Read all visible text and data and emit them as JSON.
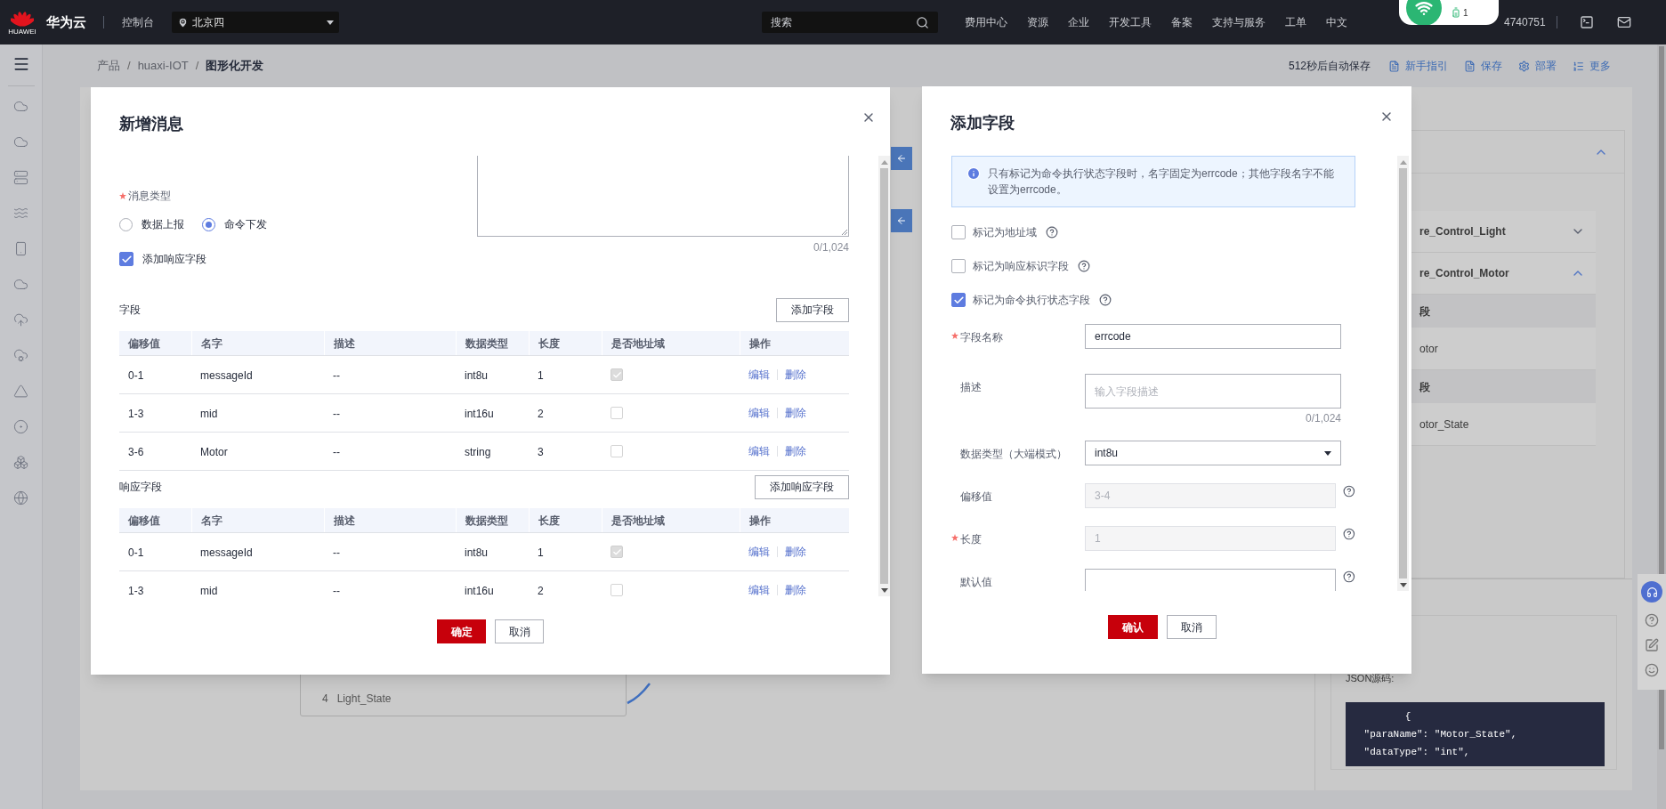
{
  "top_bar": {
    "logo_text": "HUAWEI",
    "brand": "华为云",
    "console": "控制台",
    "region": "北京四",
    "search_placeholder": "搜索",
    "nav": [
      "费用中心",
      "资源",
      "企业",
      "开发工具",
      "备案",
      "支持与服务",
      "工单",
      "中文"
    ],
    "account": "4740751"
  },
  "status_pill": {
    "count": "1"
  },
  "breadcrumb": [
    {
      "label": "产品",
      "current": false
    },
    {
      "separator": "/",
      "label": "huaxi-IOT",
      "current": false
    },
    {
      "separator": "/",
      "label": "图形化开发",
      "current": true
    }
  ],
  "toolbar": {
    "autosave": "512秒后自动保存",
    "actions": [
      "新手指引",
      "保存",
      "部署",
      "更多"
    ]
  },
  "side_panel": {
    "expanded": true,
    "items": [
      {
        "label": "re_Control_Light",
        "expanded": false
      },
      {
        "label": "re_Control_Motor",
        "expanded": true
      }
    ],
    "sections": [
      {
        "header": "段",
        "item": "otor"
      },
      {
        "header": "段",
        "item": "otor_State"
      }
    ],
    "json_label": "JSON源码:",
    "code_lines": [
      "        {",
      " \"paraName\": \"Motor_State\",",
      " \"dataType\": \"int\","
    ]
  },
  "node_card": {
    "index": "4",
    "label": "Light_State"
  },
  "message_dialog": {
    "title": "新增消息",
    "counter": "0/1,024",
    "type_label": "消息类型",
    "type_required": true,
    "radios": [
      {
        "label": "数据上报",
        "selected": false
      },
      {
        "label": "命令下发",
        "selected": true
      }
    ],
    "response_checkbox": {
      "label": "添加响应字段",
      "checked": true
    },
    "tables": [
      {
        "title": "字段",
        "add_button": "添加字段",
        "columns": [
          "偏移值",
          "名字",
          "描述",
          "数据类型",
          "长度",
          "是否地址域",
          "操作"
        ],
        "rows": [
          {
            "cells": [
              "0-1",
              "messageId",
              "--",
              "int8u",
              "1"
            ],
            "address": true,
            "actions": [
              "编辑",
              "删除"
            ]
          },
          {
            "cells": [
              "1-3",
              "mid",
              "--",
              "int16u",
              "2"
            ],
            "address": false,
            "actions": [
              "编辑",
              "删除"
            ]
          },
          {
            "cells": [
              "3-6",
              "Motor",
              "--",
              "string",
              "3"
            ],
            "address": false,
            "actions": [
              "编辑",
              "删除"
            ]
          }
        ]
      },
      {
        "title": "响应字段",
        "add_button": "添加响应字段",
        "columns": [
          "偏移值",
          "名字",
          "描述",
          "数据类型",
          "长度",
          "是否地址域",
          "操作"
        ],
        "rows": [
          {
            "cells": [
              "0-1",
              "messageId",
              "--",
              "int8u",
              "1"
            ],
            "address": true,
            "actions": [
              "编辑",
              "删除"
            ]
          },
          {
            "cells": [
              "1-3",
              "mid",
              "--",
              "int16u",
              "2"
            ],
            "address": false,
            "actions": [
              "编辑",
              "删除"
            ]
          }
        ]
      }
    ],
    "buttons": [
      "确定",
      "取消"
    ]
  },
  "field_dialog": {
    "title": "添加字段",
    "notice": "只有标记为命令执行状态字段时，名字固定为errcode；其他字段名字不能设置为errcode。",
    "checkboxes": [
      {
        "label": "标记为地址域",
        "checked": false
      },
      {
        "label": "标记为响应标识字段",
        "checked": false
      },
      {
        "label": "标记为命令执行状态字段",
        "checked": true
      }
    ],
    "rows": [
      {
        "kind": "input",
        "label": "字段名称",
        "required": true,
        "value": "errcode",
        "disabled": false,
        "help": false
      },
      {
        "kind": "textarea",
        "label": "描述",
        "required": false,
        "placeholder": "输入字段描述",
        "counter": "0/1,024",
        "disabled": false,
        "help": false
      },
      {
        "kind": "select",
        "label": "数据类型（大端模式）",
        "required": false,
        "value": "int8u",
        "disabled": false,
        "help": false
      },
      {
        "kind": "input",
        "label": "偏移值",
        "required": false,
        "value": "3-4",
        "disabled": true,
        "help": true
      },
      {
        "kind": "input",
        "label": "长度",
        "required": true,
        "value": "1",
        "disabled": true,
        "help": true
      },
      {
        "kind": "input",
        "label": "默认值",
        "required": false,
        "disabled": false,
        "help": true
      }
    ],
    "buttons": [
      "确认",
      "取消"
    ]
  }
}
